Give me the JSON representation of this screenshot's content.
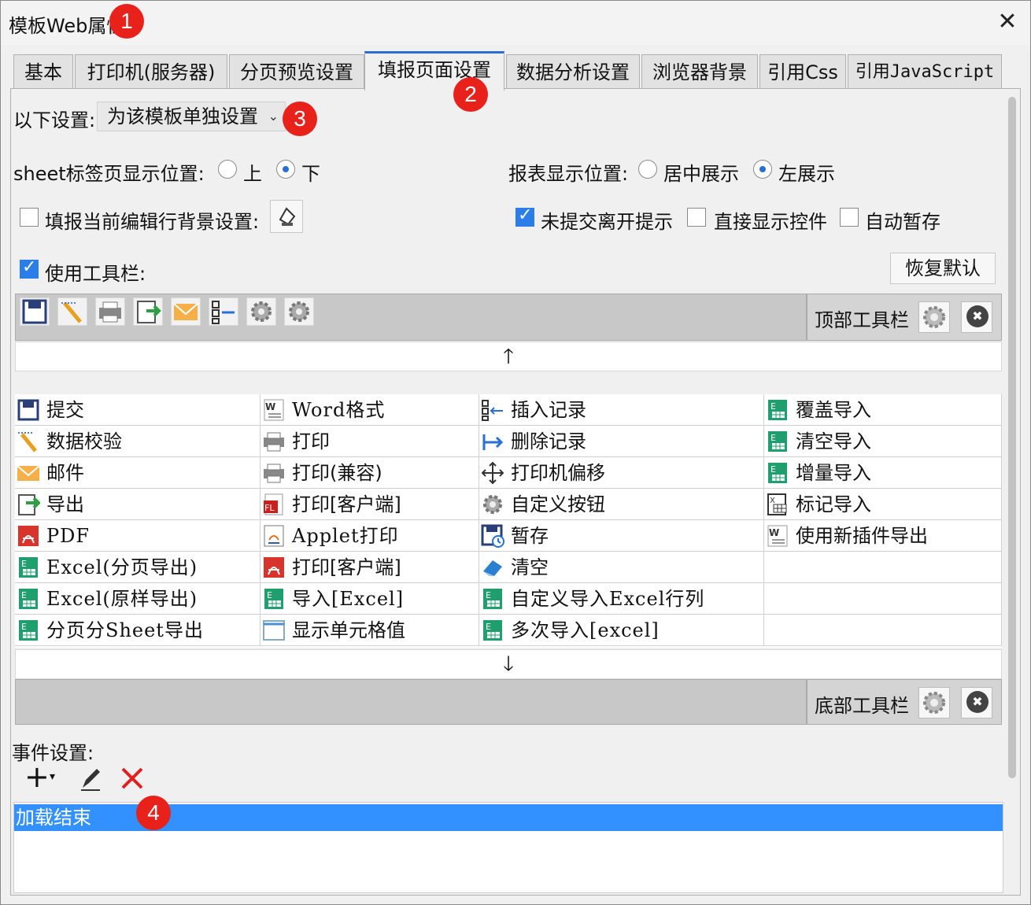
{
  "window": {
    "title": "模板Web属性",
    "close_label": "✕"
  },
  "badges": [
    "1",
    "2",
    "3",
    "4"
  ],
  "tabs": [
    "基本",
    "打印机(服务器)",
    "分页预览设置",
    "填报页面设置",
    "数据分析设置",
    "浏览器背景",
    "引用Css",
    "引用JavaScript"
  ],
  "settings": {
    "scope_label": "以下设置:",
    "scope_value": "为该模板单独设置",
    "sheet_pos_label": "sheet标签页显示位置:",
    "sheet_pos_options": [
      "上",
      "下"
    ],
    "sheet_pos_selected": "下",
    "report_pos_label": "报表显示位置:",
    "report_pos_options": [
      "居中展示",
      "左展示"
    ],
    "report_pos_selected": "左展示",
    "row_bg_label": "填报当前编辑行背景设置:",
    "row_bg_checked": false,
    "unsubmitted_label": "未提交离开提示",
    "unsubmitted_checked": true,
    "show_widget_label": "直接显示控件",
    "show_widget_checked": false,
    "autosave_label": "自动暂存",
    "autosave_checked": false,
    "use_toolbar_label": "使用工具栏:",
    "use_toolbar_checked": true,
    "restore_default_label": "恢复默认"
  },
  "top_toolbar": {
    "label": "顶部工具栏",
    "icons": [
      "save-icon",
      "validate-icon",
      "print-icon",
      "export-icon",
      "mail-icon",
      "insert-record-icon",
      "gear-icon",
      "gear-icon"
    ]
  },
  "bottom_toolbar": {
    "label": "底部工具栏"
  },
  "arrows": {
    "up": "🡑",
    "down": "🡓"
  },
  "button_grid": {
    "columns": [
      [
        "提交",
        "数据校验",
        "邮件",
        "导出",
        "PDF",
        "Excel(分页导出)",
        "Excel(原样导出)",
        "分页分Sheet导出"
      ],
      [
        "Word格式",
        "打印",
        "打印(兼容)",
        "打印[客户端]",
        "Applet打印",
        "打印[客户端]",
        "导入[Excel]",
        "显示单元格值"
      ],
      [
        "插入记录",
        "删除记录",
        "打印机偏移",
        "自定义按钮",
        "暂存",
        "清空",
        "自定义导入Excel行列",
        "多次导入[excel]"
      ],
      [
        "覆盖导入",
        "清空导入",
        "增量导入",
        "标记导入",
        "使用新插件导出"
      ]
    ],
    "icons": [
      [
        "save-icon",
        "validate-icon",
        "mail-icon",
        "export-icon",
        "pdf-icon",
        "excel-icon",
        "excel-icon",
        "excel-icon"
      ],
      [
        "word-icon",
        "print-icon",
        "print-icon",
        "fl-print-icon",
        "applet-icon",
        "pdf-icon",
        "excel-icon",
        "cell-icon"
      ],
      [
        "insert-record-icon",
        "delete-record-icon",
        "move-icon",
        "gear-icon",
        "save-clock-icon",
        "eraser-icon",
        "excel-icon",
        "excel-icon"
      ],
      [
        "excel-icon",
        "excel-icon",
        "excel-icon",
        "excel-mark-icon",
        "word-icon"
      ]
    ]
  },
  "events": {
    "label": "事件设置:",
    "add_label": "+",
    "items": [
      "加载结束"
    ]
  },
  "colors": {
    "selection": "#3390ff",
    "badge": "#e8211b",
    "tab_accent": "#2b6fd6",
    "check": "#2b7de9"
  }
}
